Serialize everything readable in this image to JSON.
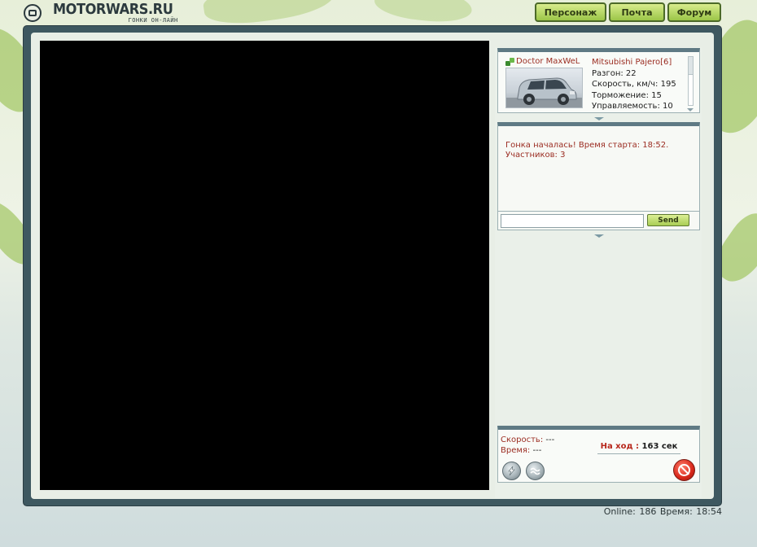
{
  "header": {
    "logo_title": "MOTORWARS.RU",
    "logo_subtitle": "ГОНКИ ОН-ЛАЙН"
  },
  "nav": [
    {
      "label": "Персонаж"
    },
    {
      "label": "Почта"
    },
    {
      "label": "Форум"
    }
  ],
  "car_panel": {
    "driver_name": "Doctor MaxWeL",
    "car_model": "Mitsubishi Pajero[6]",
    "stats": [
      "Разгон: 22",
      "Скорость, км/ч: 195",
      "Торможение: 15",
      "Управляемость: 10"
    ]
  },
  "chat": {
    "messages": [
      "Гонка началась! Время старта: 18:52.",
      "Участников: 3"
    ],
    "input_value": "",
    "send_label": "Send"
  },
  "race": {
    "speed_label": "Скорость:",
    "speed_value": "---",
    "time_label": "Время:",
    "time_value": "---",
    "turn_label": "На ход :",
    "turn_value": "163 сек"
  },
  "footer": {
    "online_label": "Online:",
    "online_count": "186",
    "time_label": "Время:",
    "time_value": "18:54"
  },
  "colors": {
    "accent_red": "#9b2d22",
    "nav_green": "#9bc548",
    "frame_dark": "#3e5860"
  },
  "icons": {
    "logo": "wheel-logo-icon",
    "driver": "driver-status-icon",
    "boost": "lightning-icon",
    "brake": "waves-icon",
    "stop": "stop-icon"
  }
}
